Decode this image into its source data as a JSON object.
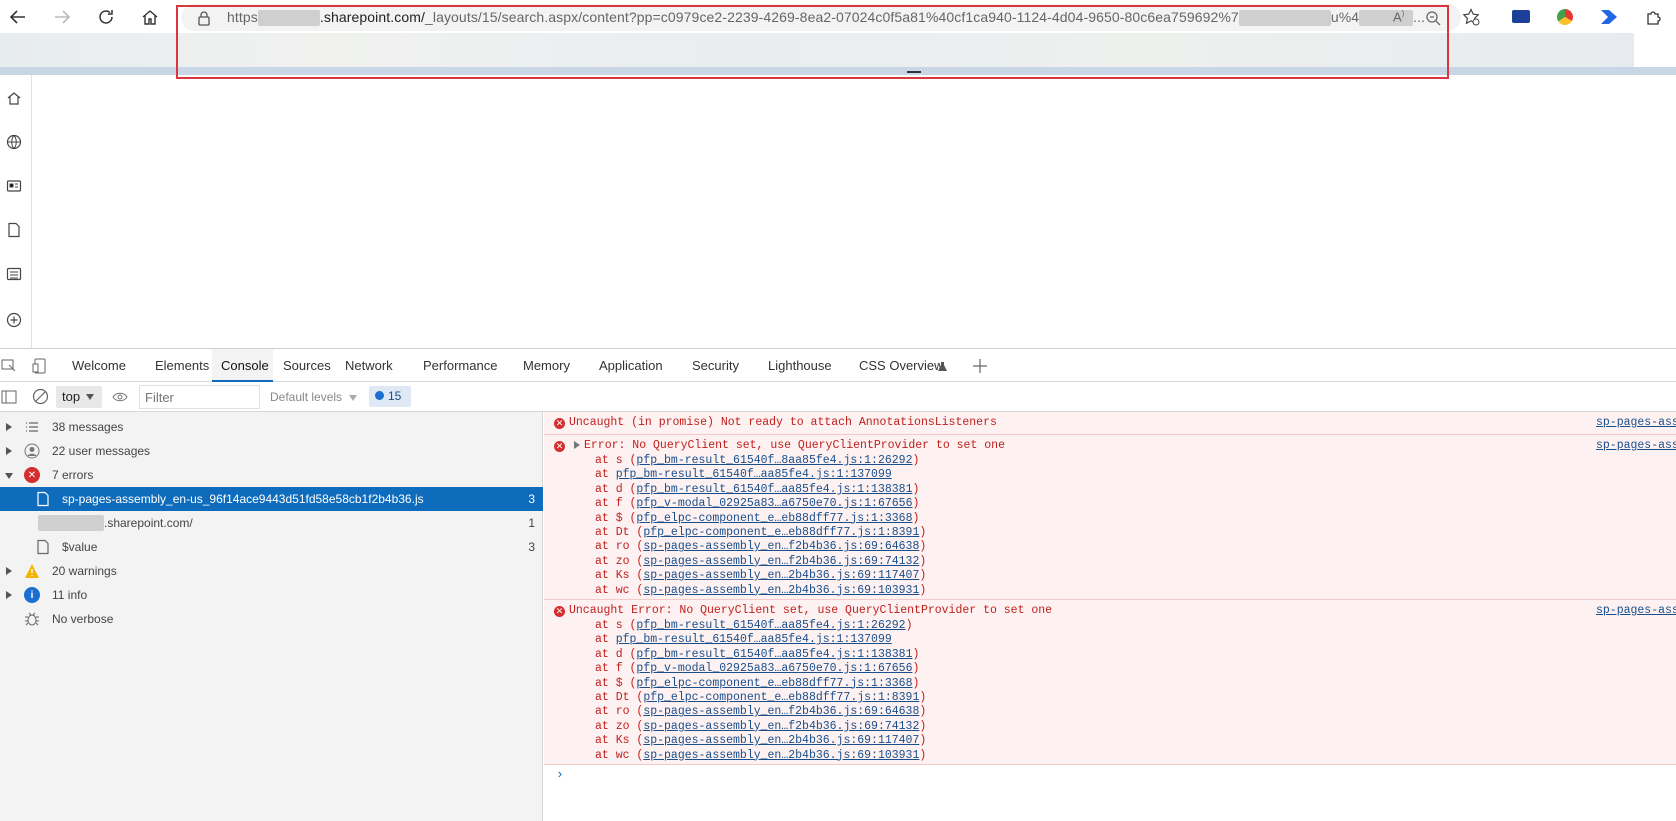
{
  "browser": {
    "url_prefix": "https",
    "url_host": ".sharepoint.com/",
    "url_path": "_layouts/15/search.aspx/content?pp=c0979ce2-2239-4269-8ea2-07024c0f5a81%40cf1ca940-1124-4d04-9650-80c6ea759692%7",
    "url_tail": "u%4",
    "url_ellipsis": "..."
  },
  "devtools": {
    "tabs": [
      "Welcome",
      "Elements",
      "Console",
      "Sources",
      "Network",
      "Performance",
      "Memory",
      "Application",
      "Security",
      "Lighthouse",
      "CSS Overview"
    ],
    "context": "top",
    "filter_placeholder": "Filter",
    "levels": "Default levels",
    "issues_count": "15"
  },
  "sidebar": {
    "items": [
      {
        "label": "38 messages",
        "count": ""
      },
      {
        "label": "22 user messages",
        "count": ""
      },
      {
        "label": "7 errors",
        "count": ""
      },
      {
        "label": "sp-pages-assembly_en-us_96f14ace9443d51fd58e58cb1f2b4b36.js",
        "count": "3"
      },
      {
        "label": ".sharepoint.com/",
        "count": "1"
      },
      {
        "label": "$value",
        "count": "3"
      },
      {
        "label": "20 warnings",
        "count": ""
      },
      {
        "label": "11 info",
        "count": ""
      },
      {
        "label": "No verbose",
        "count": ""
      }
    ]
  },
  "console": {
    "source": "sp-pages-asse",
    "msg1": "Uncaught (in promise) Not ready to attach AnnotationsListeners",
    "msg2": "Error: No QueryClient set, use QueryClientProvider to set one",
    "msg3": "Uncaught Error: No QueryClient set, use QueryClientProvider to set one",
    "stack": [
      {
        "fn": "at s (",
        "link": "pfp_bm-result_61540f…8aa85fe4.js:1:26292",
        "end": ")"
      },
      {
        "fn": "at ",
        "link": "pfp_bm-result_61540f…aa85fe4.js:1:137099",
        "end": ""
      },
      {
        "fn": "at d (",
        "link": "pfp_bm-result_61540f…aa85fe4.js:1:138381",
        "end": ")"
      },
      {
        "fn": "at f (",
        "link": "pfp_v-modal_02925a83…a6750e70.js:1:67656",
        "end": ")"
      },
      {
        "fn": "at $ (",
        "link": "pfp_elpc-component_e…eb88dff77.js:1:3368",
        "end": ")"
      },
      {
        "fn": "at Dt (",
        "link": "pfp_elpc-component_e…eb88dff77.js:1:8391",
        "end": ")"
      },
      {
        "fn": "at ro (",
        "link": "sp-pages-assembly_en…f2b4b36.js:69:64638",
        "end": ")"
      },
      {
        "fn": "at zo (",
        "link": "sp-pages-assembly_en…f2b4b36.js:69:74132",
        "end": ")"
      },
      {
        "fn": "at Ks (",
        "link": "sp-pages-assembly_en…2b4b36.js:69:117407",
        "end": ")"
      },
      {
        "fn": "at wc (",
        "link": "sp-pages-assembly_en…2b4b36.js:69:103931",
        "end": ")"
      }
    ],
    "stack2": [
      {
        "fn": "at s (",
        "link": "pfp_bm-result_61540f…aa85fe4.js:1:26292",
        "end": ")"
      },
      {
        "fn": "at ",
        "link": "pfp_bm-result_61540f…aa85fe4.js:1:137099",
        "end": ""
      },
      {
        "fn": "at d (",
        "link": "pfp_bm-result_61540f…aa85fe4.js:1:138381",
        "end": ")"
      },
      {
        "fn": "at f (",
        "link": "pfp_v-modal_02925a83…a6750e70.js:1:67656",
        "end": ")"
      },
      {
        "fn": "at $ (",
        "link": "pfp_elpc-component_e…eb88dff77.js:1:3368",
        "end": ")"
      },
      {
        "fn": "at Dt (",
        "link": "pfp_elpc-component_e…eb88dff77.js:1:8391",
        "end": ")"
      },
      {
        "fn": "at ro (",
        "link": "sp-pages-assembly_en…f2b4b36.js:69:64638",
        "end": ")"
      },
      {
        "fn": "at zo (",
        "link": "sp-pages-assembly_en…f2b4b36.js:69:74132",
        "end": ")"
      },
      {
        "fn": "at Ks (",
        "link": "sp-pages-assembly_en…2b4b36.js:69:117407",
        "end": ")"
      },
      {
        "fn": "at wc (",
        "link": "sp-pages-assembly_en…2b4b36.js:69:103931",
        "end": ")"
      }
    ],
    "prompt": "›"
  },
  "colors": {
    "accent": "#0f6cbd",
    "error": "#c0211e",
    "highlight": "#d9363e"
  }
}
